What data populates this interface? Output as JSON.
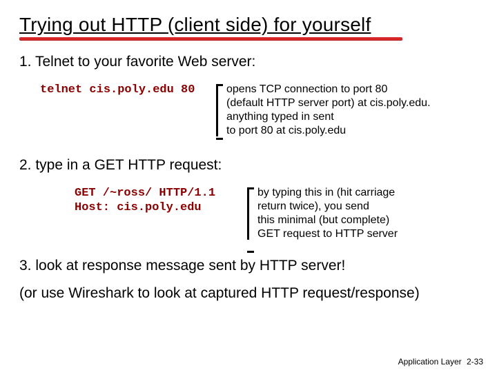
{
  "title": "Trying out HTTP (client side) for yourself",
  "step1": "1. Telnet to your favorite Web server:",
  "row1": {
    "code": "telnet cis.poly.edu 80",
    "expl": "opens TCP connection to port 80\n(default HTTP server port) at cis.poly.edu.\nanything typed in sent\nto port 80 at cis.poly.edu"
  },
  "step2": "2. type in a GET HTTP request:",
  "row2": {
    "code": "GET /~ross/ HTTP/1.1\nHost: cis.poly.edu",
    "expl": "by typing this in (hit carriage\nreturn twice), you send\nthis minimal (but complete)\nGET request to HTTP server"
  },
  "step3": "3. look at response message sent by HTTP server!",
  "step4": "(or use Wireshark to look at captured HTTP request/response)",
  "footer": {
    "label": "Application Layer",
    "page": "2-33"
  }
}
